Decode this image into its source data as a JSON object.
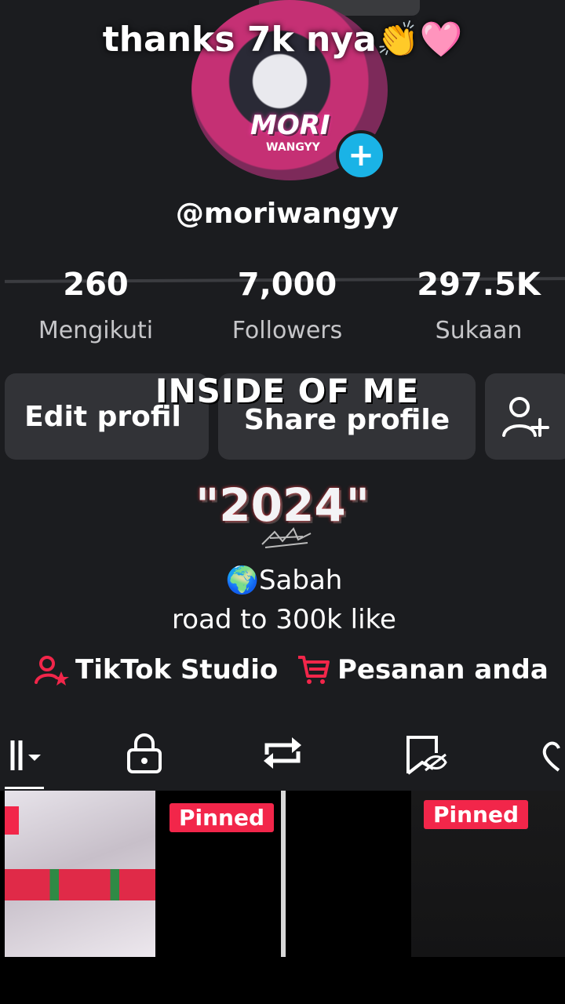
{
  "profile": {
    "overlay_caption": "thanks 7k nya👏🩷",
    "avatar_text": "MORI",
    "avatar_subtext": "WANGYY",
    "username": "@moriwangyy"
  },
  "stats": [
    {
      "value": "260",
      "label": "Mengikuti"
    },
    {
      "value": "7,000",
      "label": "Followers"
    },
    {
      "value": "297.5K",
      "label": "Sukaan"
    }
  ],
  "buttons": {
    "edit": "Edit profil",
    "share": "Share profile",
    "overlay_title": "INSIDE OF ME"
  },
  "bio": {
    "year": "\"2024\"",
    "location": "🌍Sabah",
    "tagline": "road to 300k like"
  },
  "links": {
    "studio": "TikTok Studio",
    "orders": "Pesanan anda"
  },
  "grid": {
    "pinned_label": "Pinned"
  },
  "colors": {
    "background": "#1b1c1f",
    "button": "#323337",
    "accent_red": "#f2264a",
    "plus_blue": "#1ab3e6"
  }
}
